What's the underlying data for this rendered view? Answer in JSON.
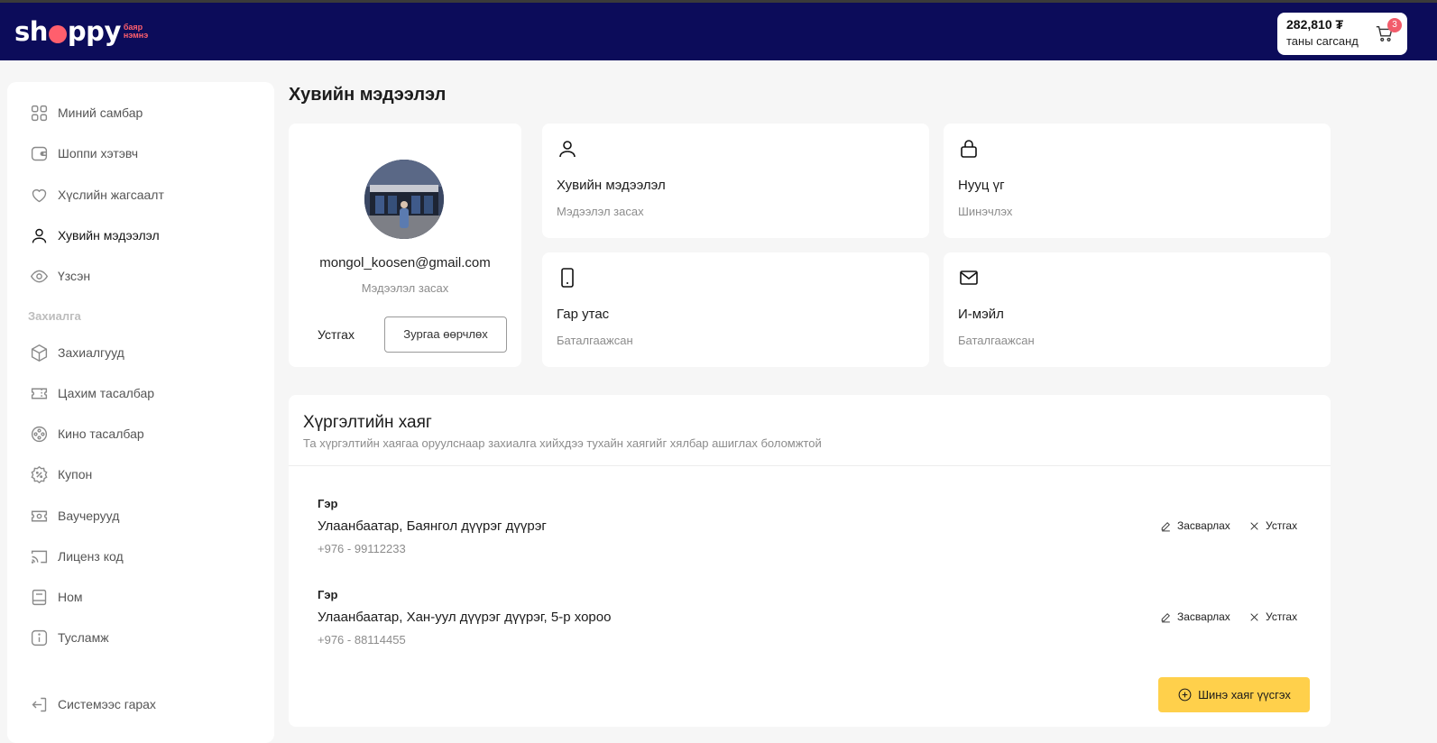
{
  "header": {
    "logo_word_pre": "sh",
    "logo_word_post": "ppy",
    "logo_tag_line1": "баяр",
    "logo_tag_line2": "нэмнэ",
    "cart_amount": "282,810 ₮",
    "cart_label": "таны сагсанд",
    "cart_count": "3"
  },
  "sidebar": {
    "items": [
      {
        "label": "Миний самбар",
        "icon": "dashboard-grid-icon"
      },
      {
        "label": "Шоппи хэтэвч",
        "icon": "wallet-icon"
      },
      {
        "label": "Хүслийн жагсаалт",
        "icon": "heart-icon"
      },
      {
        "label": "Хувийн мэдээлэл",
        "icon": "user-icon",
        "active": true
      },
      {
        "label": "Үзсэн",
        "icon": "eye-icon"
      }
    ],
    "section_label": "Захиалга",
    "order_items": [
      {
        "label": "Захиалгууд",
        "icon": "box-icon"
      },
      {
        "label": "Цахим тасалбар",
        "icon": "ticket-icon"
      },
      {
        "label": "Кино тасалбар",
        "icon": "film-reel-icon"
      },
      {
        "label": "Купон",
        "icon": "coupon-icon"
      },
      {
        "label": "Ваучерууд",
        "icon": "voucher-icon"
      },
      {
        "label": "Лиценз код",
        "icon": "cast-icon"
      },
      {
        "label": "Ном",
        "icon": "book-icon"
      },
      {
        "label": "Тусламж",
        "icon": "info-icon"
      }
    ],
    "logout_label": "Системээс гарах"
  },
  "main": {
    "title": "Хувийн мэдээлэл",
    "profile": {
      "email": "mongol_koosen@gmail.com",
      "edit_label": "Мэдээлэл засах",
      "delete_label": "Устгах",
      "change_photo_label": "Зургаа өөрчлөх"
    },
    "info_cards": [
      {
        "title": "Хувийн мэдээлэл",
        "sub": "Мэдээлэл засах",
        "icon": "user-icon"
      },
      {
        "title": "Нууц үг",
        "sub": "Шинэчлэх",
        "icon": "lock-icon"
      },
      {
        "title": "Гар утас",
        "sub": "Баталгаажсан",
        "icon": "phone-icon"
      },
      {
        "title": "И-мэйл",
        "sub": "Баталгаажсан",
        "icon": "mail-icon"
      }
    ],
    "delivery": {
      "title": "Хүргэлтийн хаяг",
      "description": "Та хүргэлтийн хаягаа оруулснаар захиалга хийхдээ тухайн хаягийг хялбар ашиглах боломжтой",
      "addresses": [
        {
          "type": "Гэр",
          "address": "Улаанбаатар, Баянгол дүүрэг дүүрэг",
          "phone": "+976 - 99112233"
        },
        {
          "type": "Гэр",
          "address": "Улаанбаатар, Хан-уул дүүрэг дүүрэг, 5-р хороо",
          "phone": "+976 - 88114455"
        }
      ],
      "edit_label": "Засварлах",
      "remove_label": "Устгах",
      "new_address_label": "Шинэ хаяг үүсгэх"
    }
  }
}
